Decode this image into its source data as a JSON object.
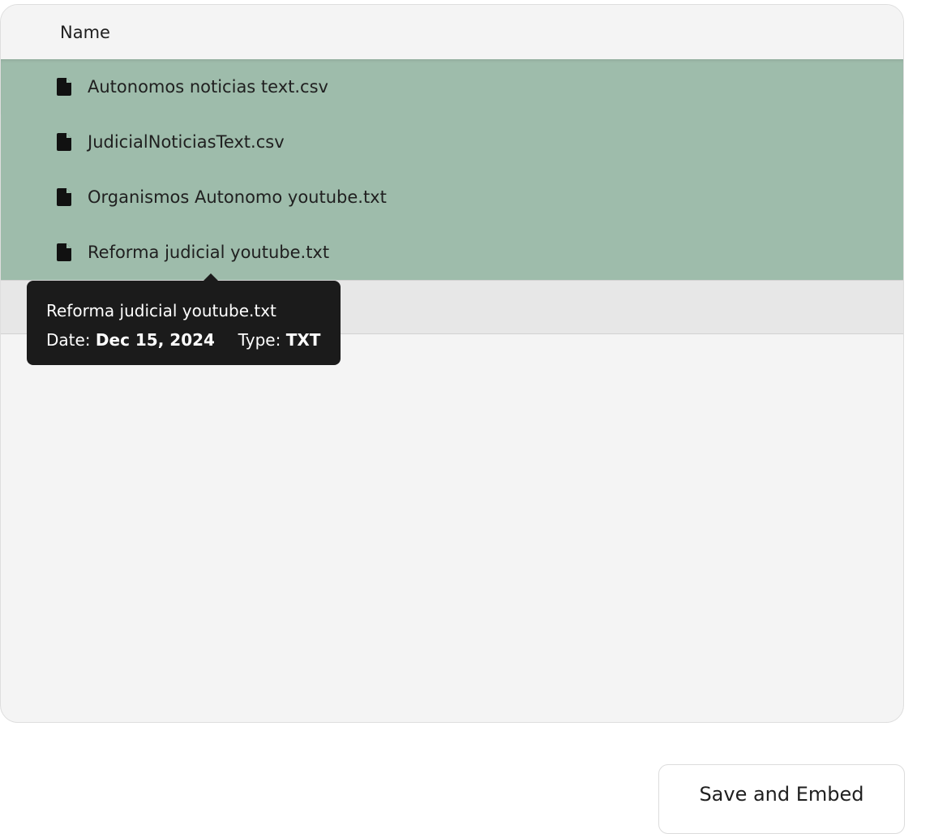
{
  "file_table": {
    "header": {
      "name_label": "Name"
    },
    "rows": [
      {
        "name": "Autonomos noticias text.csv",
        "icon": "file-icon",
        "selected": true
      },
      {
        "name": "JudicialNoticiasText.csv",
        "icon": "file-icon",
        "selected": true
      },
      {
        "name": "Organismos Autonomo youtube.txt",
        "icon": "file-icon",
        "selected": true
      },
      {
        "name": "Reforma judicial youtube.txt",
        "icon": "file-icon",
        "selected": true
      },
      {
        "name": "",
        "icon": "file-icon",
        "selected": false,
        "hovered": true
      }
    ]
  },
  "tooltip": {
    "title": "Reforma judicial youtube.txt",
    "date_label": "Date:",
    "date_value": "Dec 15, 2024",
    "type_label": "Type:",
    "type_value": "TXT"
  },
  "footer": {
    "save_label": "Save and Embed"
  },
  "colors": {
    "selected_row": "#9ebcab",
    "hover_row": "#e7e7e7",
    "panel_bg": "#f4f4f4",
    "tooltip_bg": "#1b1b1b"
  }
}
